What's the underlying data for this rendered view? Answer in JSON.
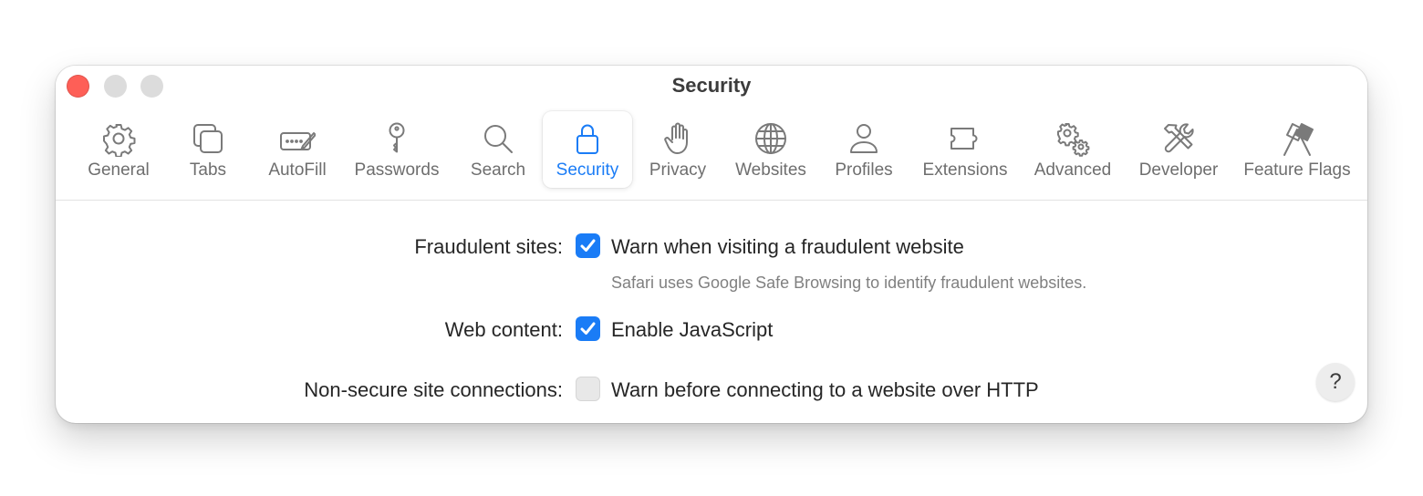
{
  "window": {
    "title": "Security"
  },
  "toolbar": {
    "active_tab": "Security",
    "tabs": [
      {
        "label": "General",
        "icon": "gear-icon"
      },
      {
        "label": "Tabs",
        "icon": "tabs-icon"
      },
      {
        "label": "AutoFill",
        "icon": "autofill-icon"
      },
      {
        "label": "Passwords",
        "icon": "key-icon"
      },
      {
        "label": "Search",
        "icon": "magnifier-icon"
      },
      {
        "label": "Security",
        "icon": "lock-icon"
      },
      {
        "label": "Privacy",
        "icon": "hand-icon"
      },
      {
        "label": "Websites",
        "icon": "globe-icon"
      },
      {
        "label": "Profiles",
        "icon": "person-icon"
      },
      {
        "label": "Extensions",
        "icon": "puzzle-icon"
      },
      {
        "label": "Advanced",
        "icon": "gears-icon"
      },
      {
        "label": "Developer",
        "icon": "tools-icon"
      },
      {
        "label": "Feature Flags",
        "icon": "flags-icon"
      }
    ]
  },
  "settings": {
    "fraudulent": {
      "label": "Fraudulent sites:",
      "option": "Warn when visiting a fraudulent website",
      "checked": true,
      "hint": "Safari uses Google Safe Browsing to identify fraudulent websites."
    },
    "web_content": {
      "label": "Web content:",
      "option": "Enable JavaScript",
      "checked": true
    },
    "non_secure": {
      "label": "Non-secure site connections:",
      "option": "Warn before connecting to a website over HTTP",
      "checked": false
    }
  },
  "help": {
    "label": "?"
  },
  "colors": {
    "accent": "#1a7cf6",
    "close": "#fe5f57",
    "inactive_light": "#dcdcdc"
  }
}
